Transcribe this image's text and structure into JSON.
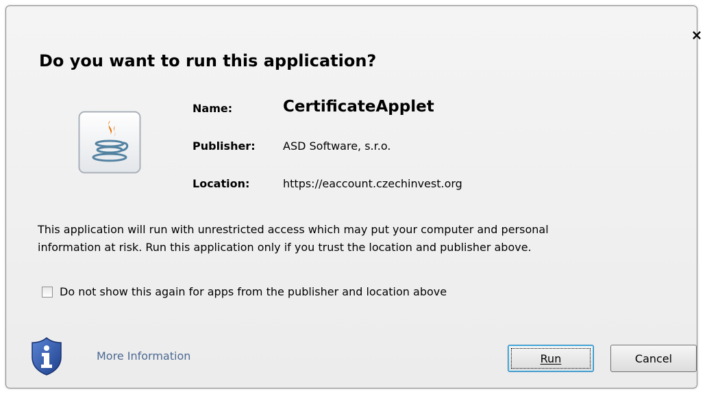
{
  "dialog": {
    "title": "Do you want to run this application?",
    "close_glyph": "×"
  },
  "app": {
    "icon": "java-icon",
    "name_label": "Name:",
    "name_value": "CertificateApplet",
    "publisher_label": "Publisher:",
    "publisher_value": "ASD Software, s.r.o.",
    "location_label": "Location:",
    "location_value": "https://eaccount.czechinvest.org"
  },
  "warning": {
    "line1": "This application will run with unrestricted access which may put your computer and personal",
    "line2": "information at risk. Run this application only if you trust the location and publisher above."
  },
  "option": {
    "checked": false,
    "label": "Do not show this again for apps from the publisher and location above"
  },
  "footer": {
    "info_icon": "shield-info-icon",
    "more_info_label": "More Information",
    "run_label": "Run",
    "cancel_label": "Cancel"
  },
  "colors": {
    "link": "#4a6892",
    "shield": "#2f5aa8",
    "java_orange": "#e76f00",
    "java_blue": "#5382a1"
  }
}
